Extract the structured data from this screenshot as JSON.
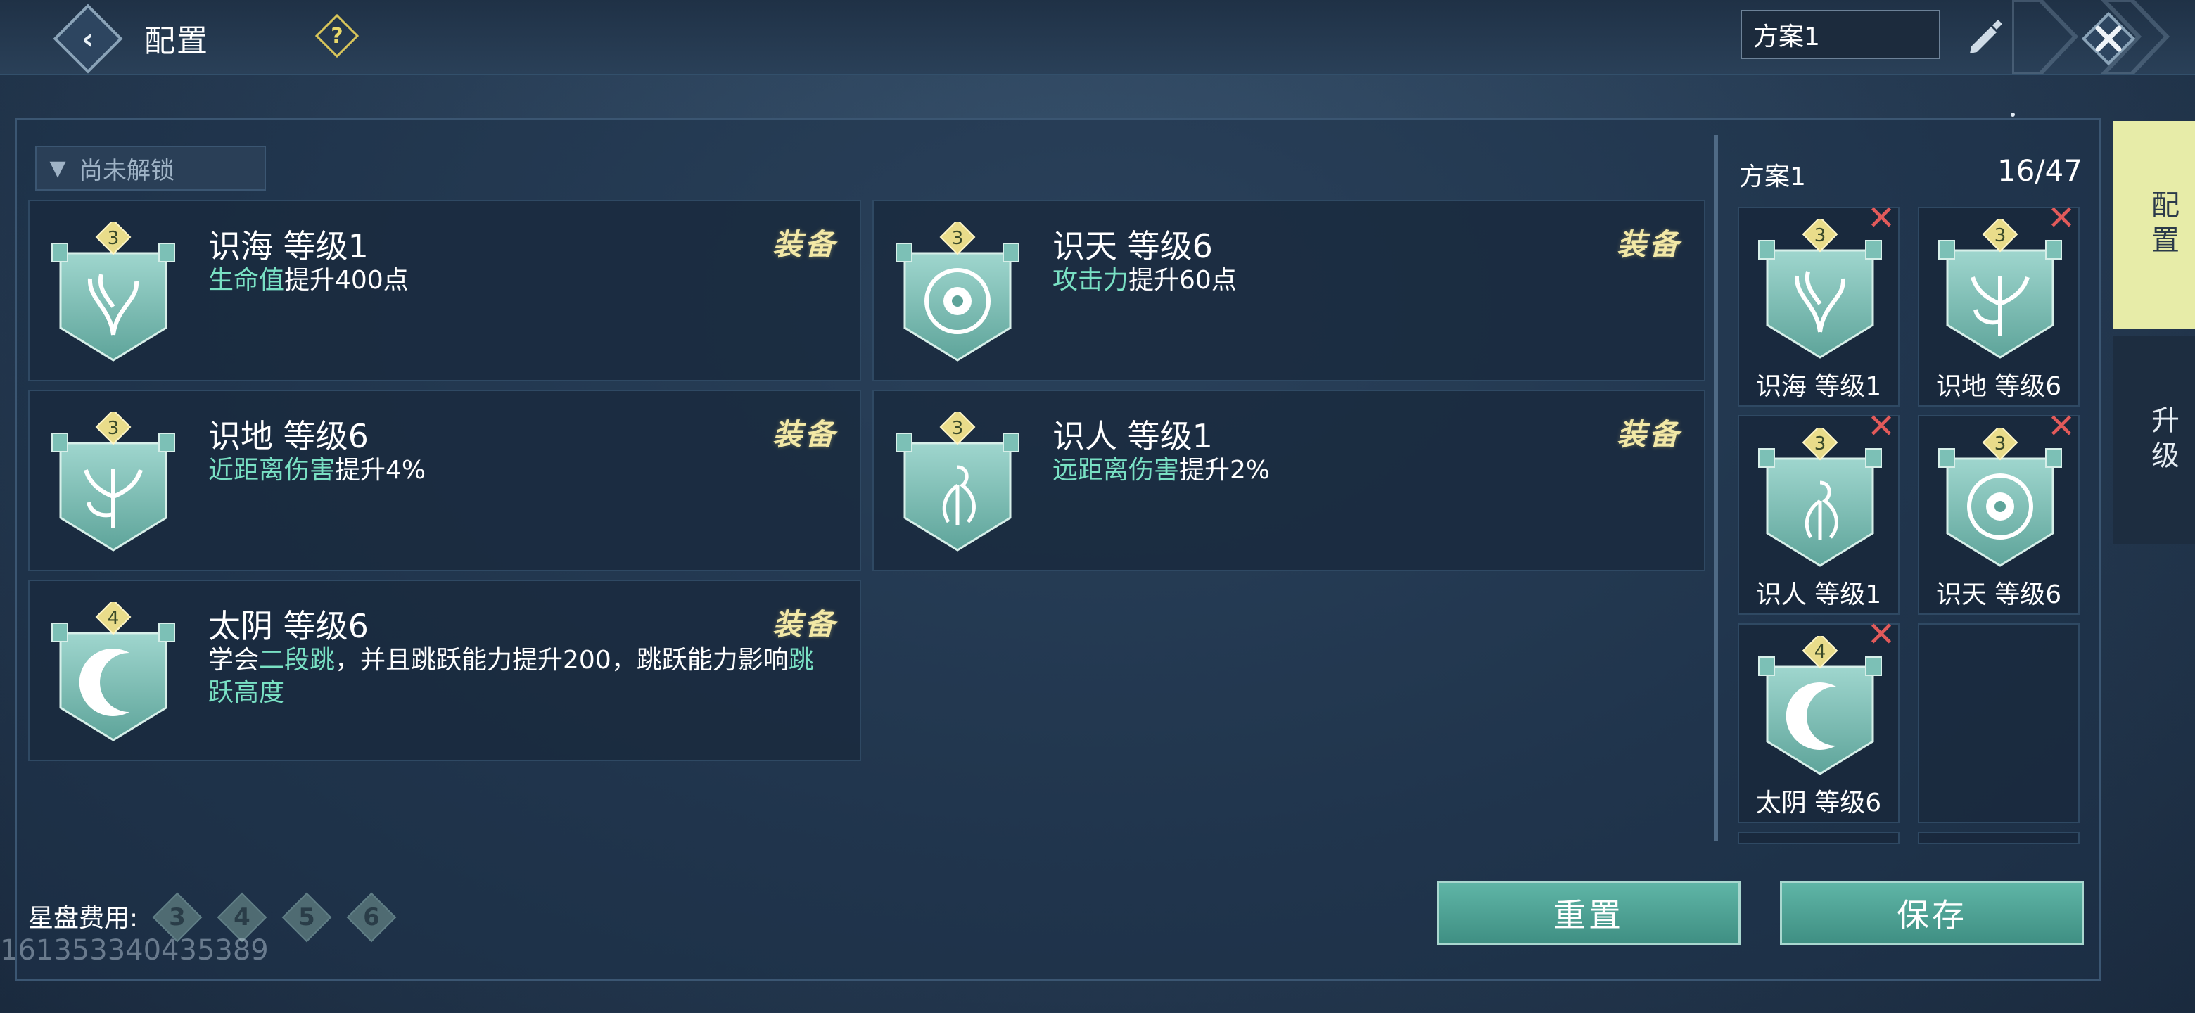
{
  "header": {
    "title": "配置",
    "plan_value": "方案1"
  },
  "filter": {
    "label": "尚未解锁"
  },
  "cards": [
    {
      "name": "识海 等级1",
      "equip": "装备",
      "stars": "3",
      "desc_hl": "生命值",
      "desc_rest": "提升400点",
      "desc_extra": "",
      "desc_tail": ""
    },
    {
      "name": "识天 等级6",
      "equip": "装备",
      "stars": "3",
      "desc_hl": "攻击力",
      "desc_rest": "提升60点",
      "desc_extra": "",
      "desc_tail": ""
    },
    {
      "name": "识地 等级6",
      "equip": "装备",
      "stars": "3",
      "desc_hl": "近距离伤害",
      "desc_rest": "提升4%",
      "desc_extra": "",
      "desc_tail": ""
    },
    {
      "name": "识人 等级1",
      "equip": "装备",
      "stars": "3",
      "desc_hl": "远距离伤害",
      "desc_rest": "提升2%",
      "desc_extra": "",
      "desc_tail": ""
    },
    {
      "name": "太阴 等级6",
      "equip": "装备",
      "stars": "4",
      "desc_pre": "学会",
      "desc_hl": "二段跳",
      "desc_rest": "，并且跳跃能力提升200，跳跃能力影响",
      "desc_tail": "跳跃高度"
    }
  ],
  "side": {
    "title": "方案1",
    "count": "16/47",
    "slots": [
      {
        "label": "识海 等级1",
        "stars": "3"
      },
      {
        "label": "识地 等级6",
        "stars": "3"
      },
      {
        "label": "识人 等级1",
        "stars": "3"
      },
      {
        "label": "识天 等级6",
        "stars": "3"
      },
      {
        "label": "太阴 等级6",
        "stars": "4"
      }
    ]
  },
  "tabs": {
    "config": "配置",
    "upgrade": "升级"
  },
  "footer": {
    "cost_label": "星盘费用:",
    "cost_values": [
      "3",
      "4",
      "5",
      "6"
    ],
    "id_text": "161353340435389",
    "reset_label": "重置",
    "save_label": "保存"
  },
  "colors": {
    "highlight": "#79e1c4",
    "equip_text": "#f2e8a6",
    "active_tab": "#e7eca8",
    "button": "#4fa396",
    "remove": "#e25a5a"
  },
  "icons": [
    "back-icon",
    "help-icon",
    "edit-icon",
    "close-icon",
    "chevron-down-icon",
    "remove-icon"
  ]
}
